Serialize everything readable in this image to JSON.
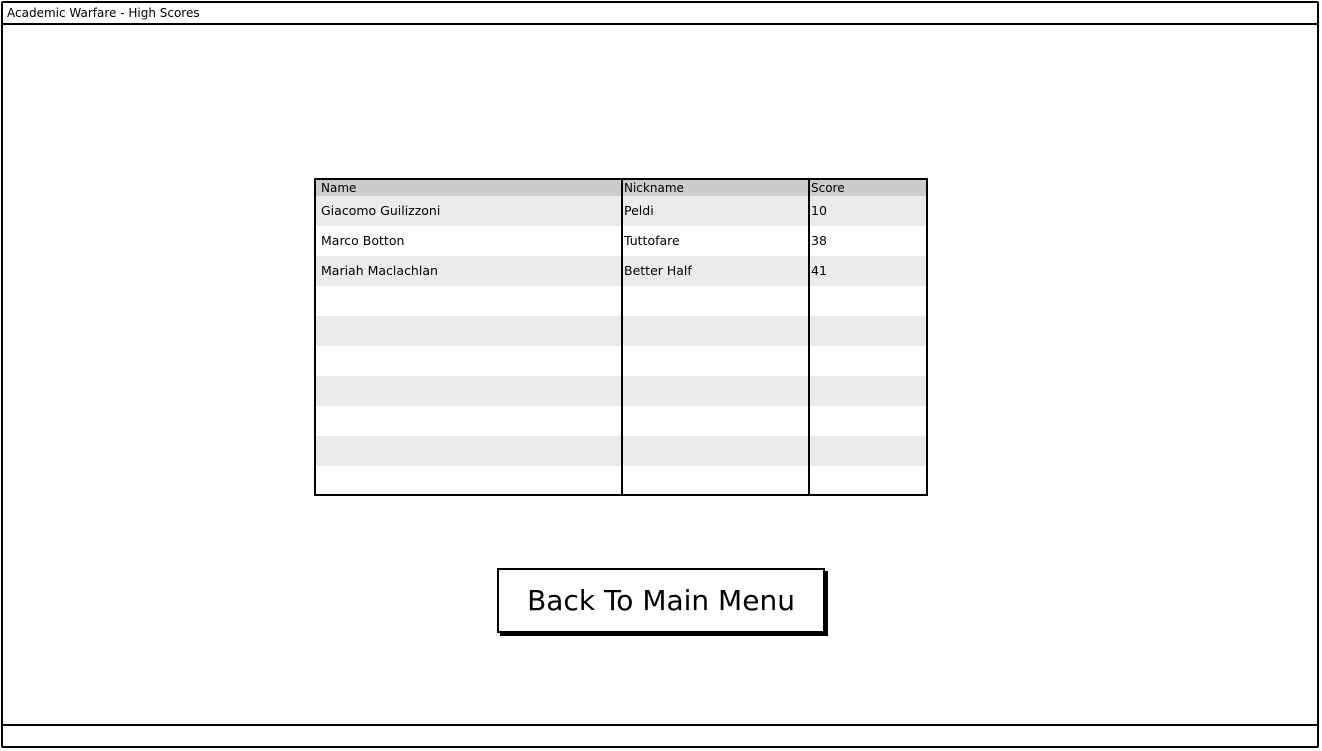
{
  "window": {
    "title": "Academic Warfare - High Scores"
  },
  "table": {
    "headers": [
      "Name",
      "Nickname",
      "Score"
    ],
    "rows": [
      [
        "Giacomo Guilizzoni",
        "Peldi",
        "10"
      ],
      [
        "Marco Botton",
        "Tuttofare",
        "38"
      ],
      [
        "Mariah Maclachlan",
        "Better Half",
        "41"
      ],
      [
        "",
        "",
        ""
      ],
      [
        "",
        "",
        ""
      ],
      [
        "",
        "",
        ""
      ],
      [
        "",
        "",
        ""
      ],
      [
        "",
        "",
        ""
      ],
      [
        "",
        "",
        ""
      ],
      [
        "",
        "",
        ""
      ]
    ]
  },
  "back_button": {
    "label": "Back To Main Menu"
  },
  "colors": {
    "header_bg": "#cccccc",
    "row_shade": "#ebebeb",
    "border": "#000000"
  }
}
